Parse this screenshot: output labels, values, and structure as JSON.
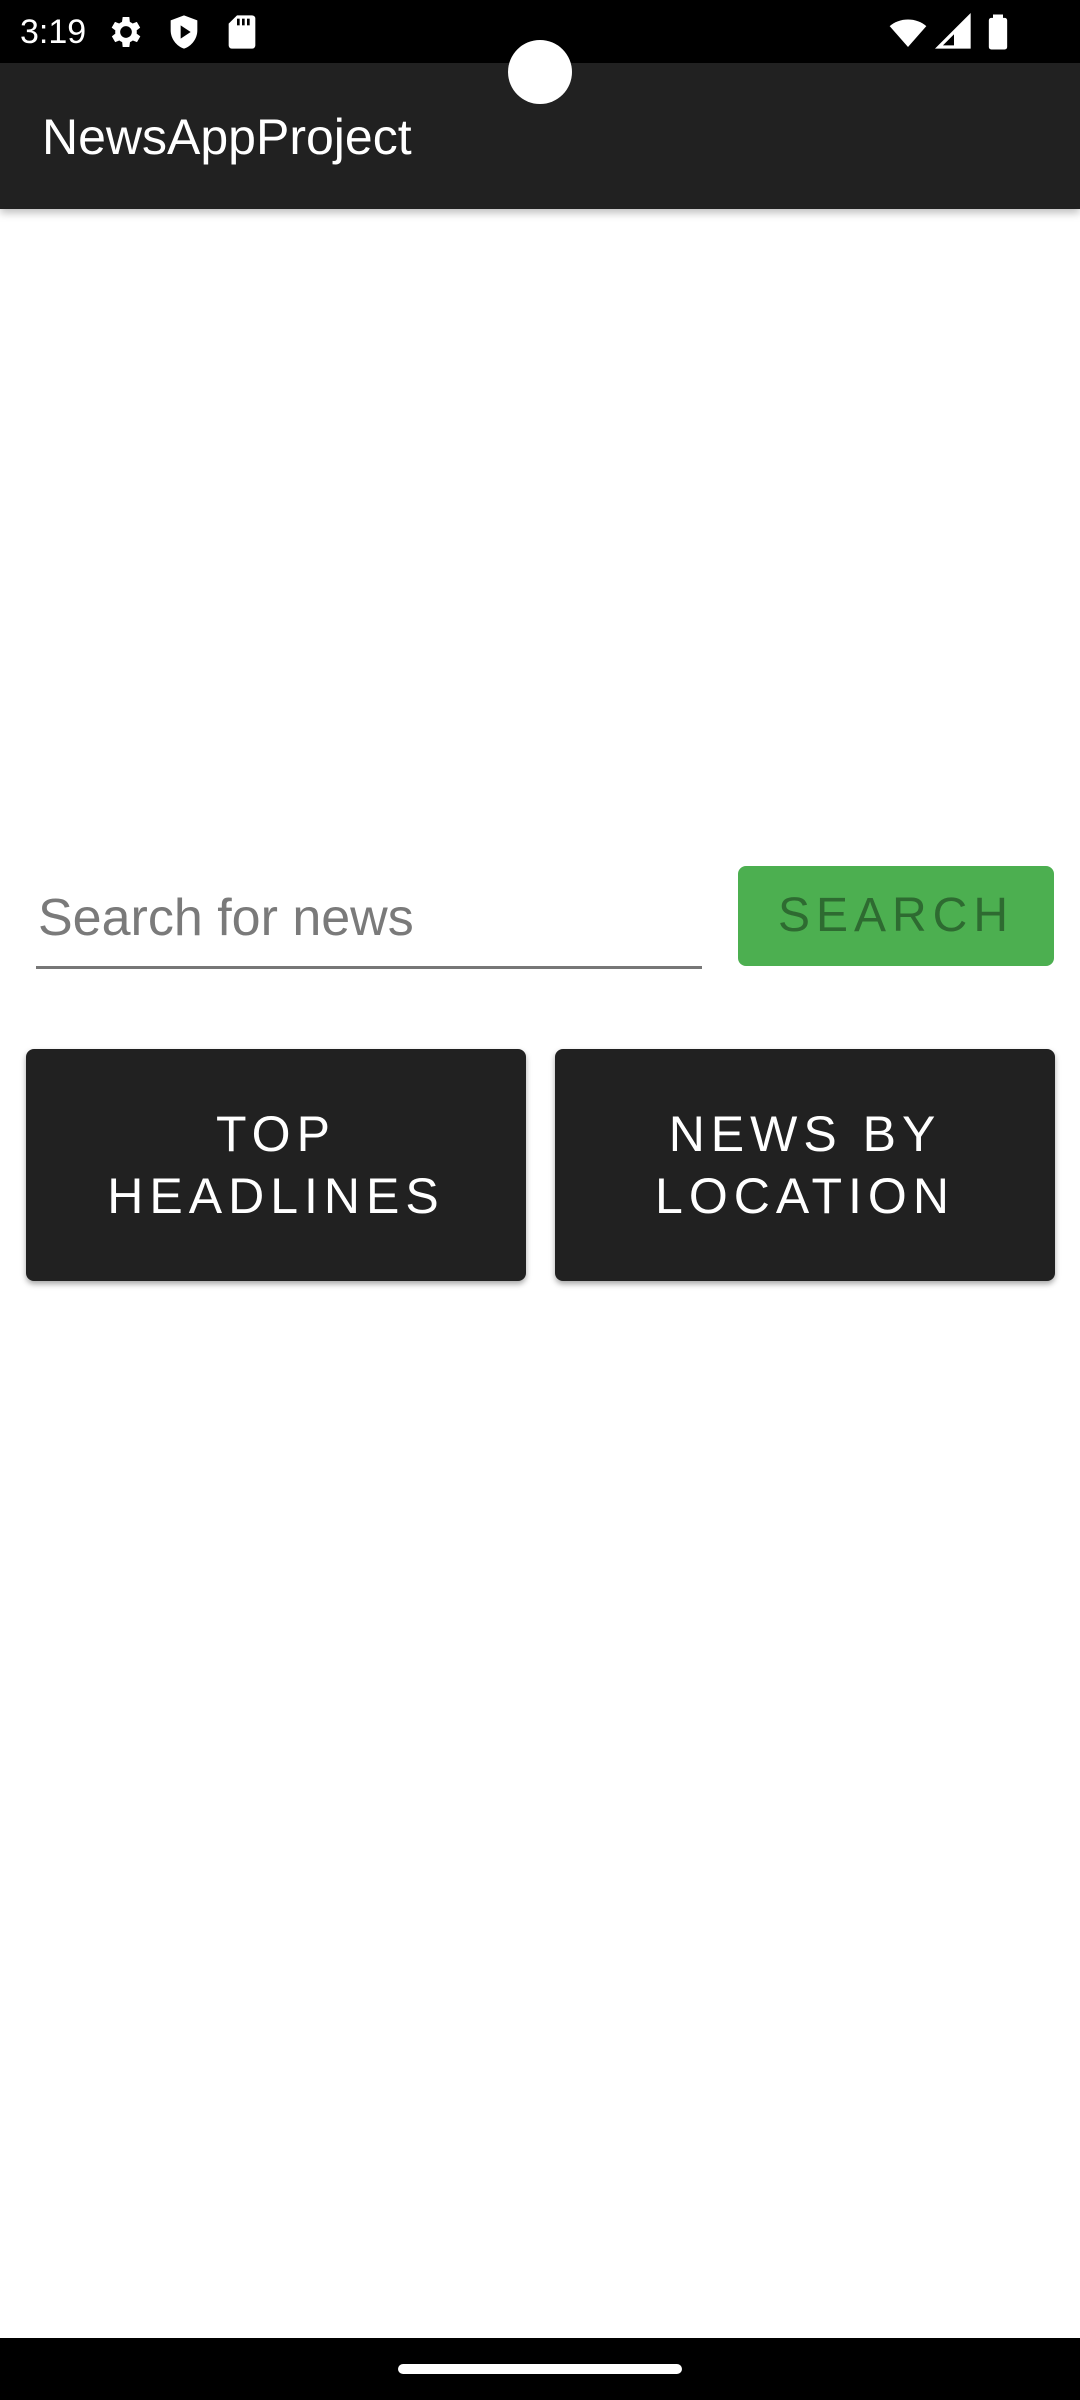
{
  "status_bar": {
    "time": "3:19",
    "left_icons": [
      "gear-icon",
      "shield-play-icon",
      "sd-card-icon"
    ],
    "right_icons": [
      "wifi-icon",
      "cell-signal-icon",
      "battery-icon"
    ]
  },
  "app_bar": {
    "title": "NewsAppProject"
  },
  "search": {
    "placeholder": "Search for news",
    "value": "",
    "button_label": "SEARCH"
  },
  "actions": {
    "top_headlines_label": "TOP HEADLINES",
    "news_by_location_label": "NEWS BY LOCATION"
  },
  "colors": {
    "app_bar": "#212121",
    "search_button": "#4caf50",
    "search_button_text": "#2e6b31",
    "action_button": "#212121"
  }
}
